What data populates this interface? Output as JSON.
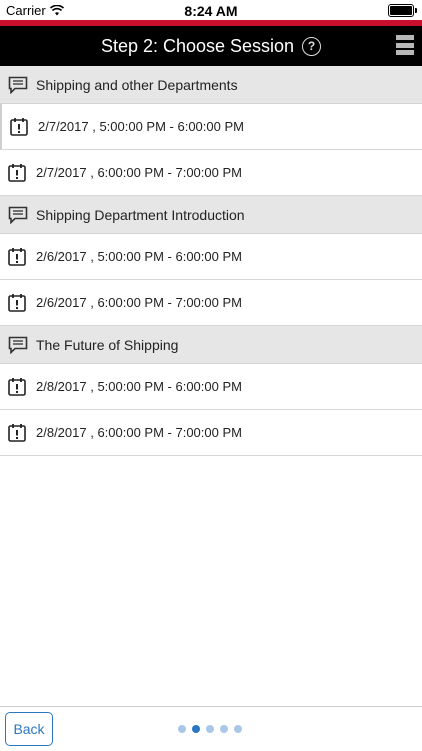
{
  "status_bar": {
    "carrier": "Carrier",
    "time": "8:24 AM"
  },
  "header": {
    "title": "Step 2: Choose Session",
    "help_glyph": "?"
  },
  "colors": {
    "accent": "#c8102e",
    "header_bg": "#000000",
    "group_bg": "#e6e6e6",
    "link": "#2b78c2"
  },
  "groups": [
    {
      "title": "Shipping and other Departments",
      "sessions": [
        "2/7/2017 , 5:00:00 PM - 6:00:00 PM",
        "2/7/2017 , 6:00:00 PM - 7:00:00 PM"
      ]
    },
    {
      "title": "Shipping Department Introduction",
      "sessions": [
        "2/6/2017 , 5:00:00 PM - 6:00:00 PM",
        "2/6/2017 , 6:00:00 PM - 7:00:00 PM"
      ]
    },
    {
      "title": "The Future of Shipping",
      "sessions": [
        "2/8/2017 , 5:00:00 PM - 6:00:00 PM",
        "2/8/2017 , 6:00:00 PM - 7:00:00 PM"
      ]
    }
  ],
  "footer": {
    "back_label": "Back",
    "page_count": 5,
    "active_page": 2
  },
  "icons": {
    "group": "chat-bubble-icon",
    "session": "calendar-alert-icon",
    "menu": "menu-icon",
    "help": "help-icon"
  }
}
